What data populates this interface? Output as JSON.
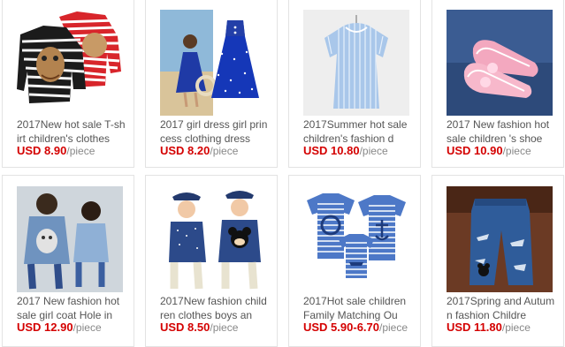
{
  "products": [
    {
      "title": "2017New hot sale T-shirt children's clothes",
      "price": "USD 8.90",
      "unit": "/piece",
      "icon": "striped-sweater-image"
    },
    {
      "title": "2017 girl dress girl princess clothing dress",
      "price": "USD 8.20",
      "unit": "/piece",
      "icon": "blue-dress-image"
    },
    {
      "title": "2017Summer hot sale children's fashion d",
      "price": "USD 10.80",
      "unit": "/piece",
      "icon": "striped-blouse-image"
    },
    {
      "title": "2017 New fashion hot sale children 's shoe",
      "price": "USD 10.90",
      "unit": "/piece",
      "icon": "pink-shoes-image"
    },
    {
      "title": "2017 New fashion hot sale girl coat Hole in",
      "price": "USD 12.90",
      "unit": "/piece",
      "icon": "denim-coat-image"
    },
    {
      "title": "2017New fashion children clothes boys an",
      "price": "USD 8.50",
      "unit": "/piece",
      "icon": "boys-shirt-image"
    },
    {
      "title": "2017Hot sale children Family Matching Ou",
      "price": "USD 5.90-6.70",
      "unit": "/piece",
      "icon": "family-tshirts-image"
    },
    {
      "title": "2017Spring and Autumn fashion Childre",
      "price": "USD 11.80",
      "unit": "/piece",
      "icon": "ripped-jeans-image"
    }
  ],
  "colors": {
    "price": "#d40000",
    "title": "#555555",
    "unit": "#888888",
    "border": "#e3e3e3"
  }
}
